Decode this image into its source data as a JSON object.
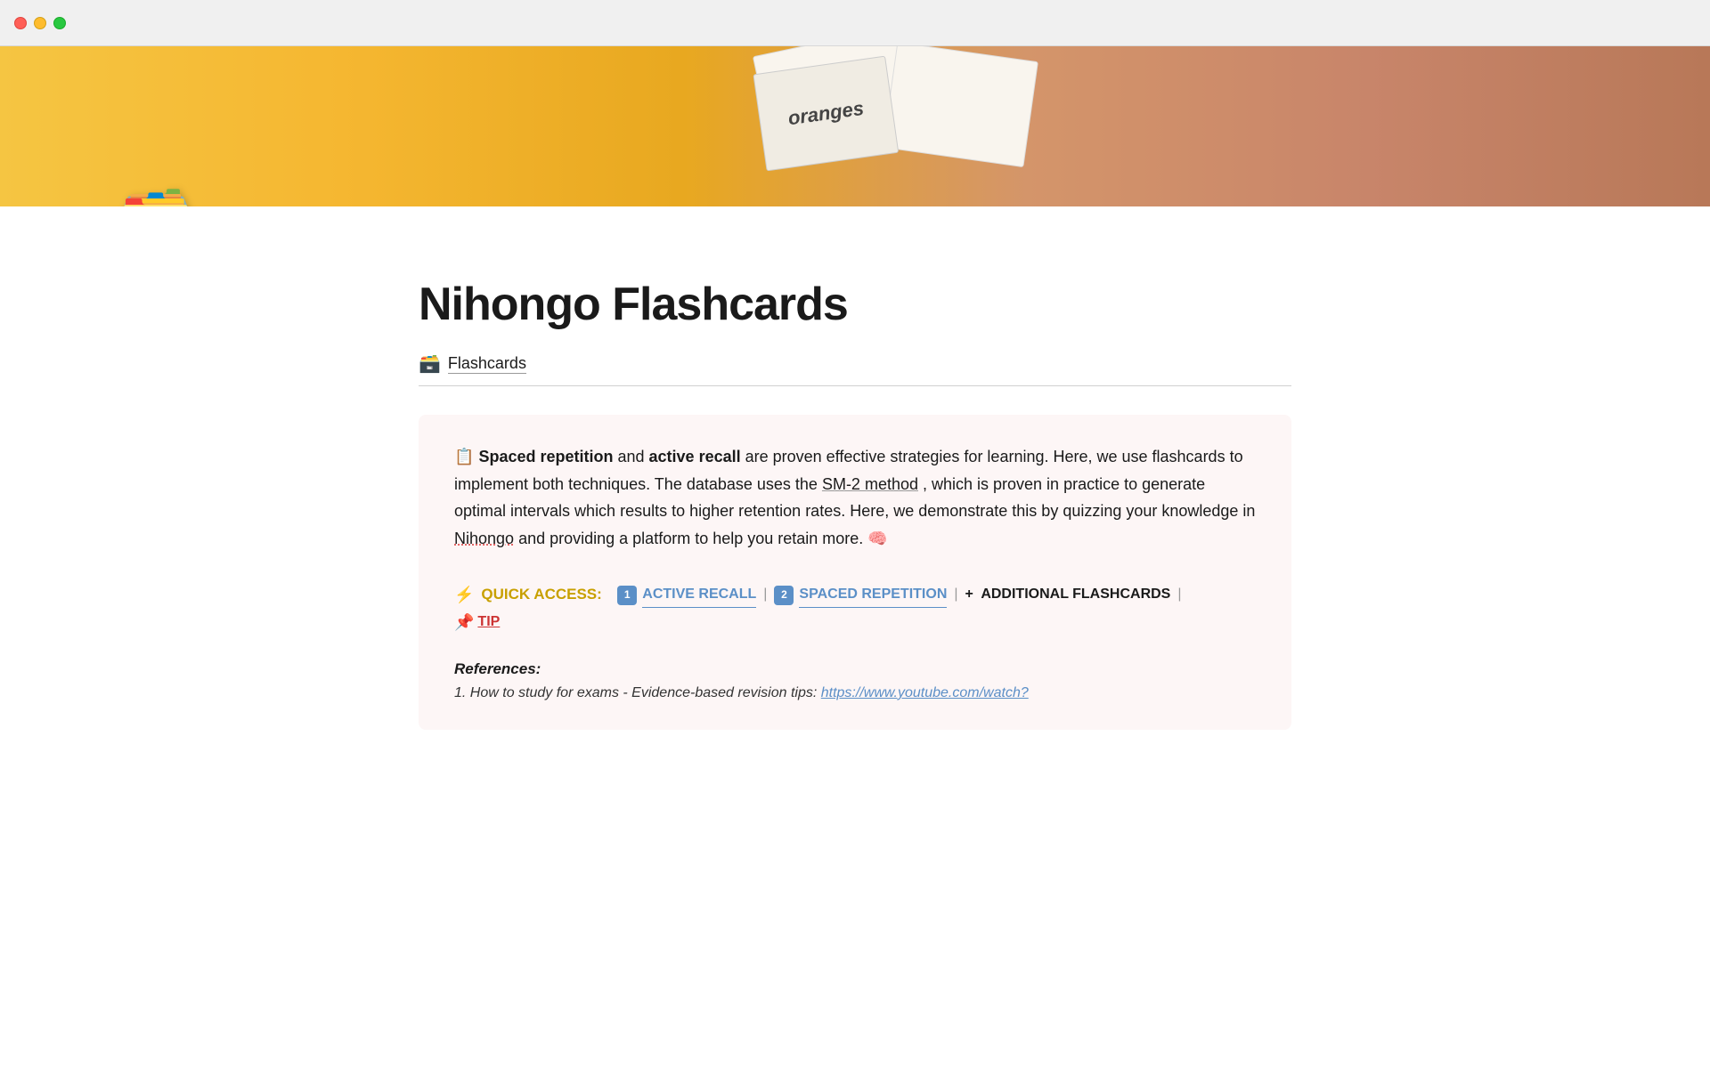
{
  "titlebar": {
    "buttons": {
      "close": "close",
      "minimize": "minimize",
      "maximize": "maximize"
    }
  },
  "hero": {
    "background_color": "#f5b731",
    "card_text": "oranges"
  },
  "page": {
    "icon": "🗃️",
    "title": "Nihongo Flashcards",
    "breadcrumb": {
      "icon": "🗃️",
      "label": "Flashcards"
    }
  },
  "info_box": {
    "intro_icon": "📋",
    "text_part1": "Spaced repetition",
    "text_part2": "and",
    "text_part3": "active recall",
    "text_part4": "are proven effective strategies for learning. Here, we use flashcards to implement both techniques. The database uses the",
    "link_text": "SM-2 method",
    "text_part5": ", which is proven in practice to generate optimal intervals which results to higher retention rates. Here, we demonstrate this by quizzing your knowledge in",
    "underline_word": "Nihongo",
    "text_part6": "and providing a platform to help you retain more.",
    "brain_emoji": "🧠"
  },
  "quick_access": {
    "lightning_icon": "⚡",
    "label": "QUICK ACCESS:",
    "badge1": "1",
    "link1_text": "ACTIVE RECALL",
    "badge2": "2",
    "link2_text": "SPACED REPETITION",
    "plus_icon": "+",
    "additional_text": "ADDITIONAL FLASHCARDS",
    "pin_icon": "📌",
    "tip_text": "TIP"
  },
  "references": {
    "title": "References:",
    "item1_text": "1. How to study for exams - Evidence-based revision tips:",
    "item1_link": "https://www.youtube.com/watch?"
  }
}
